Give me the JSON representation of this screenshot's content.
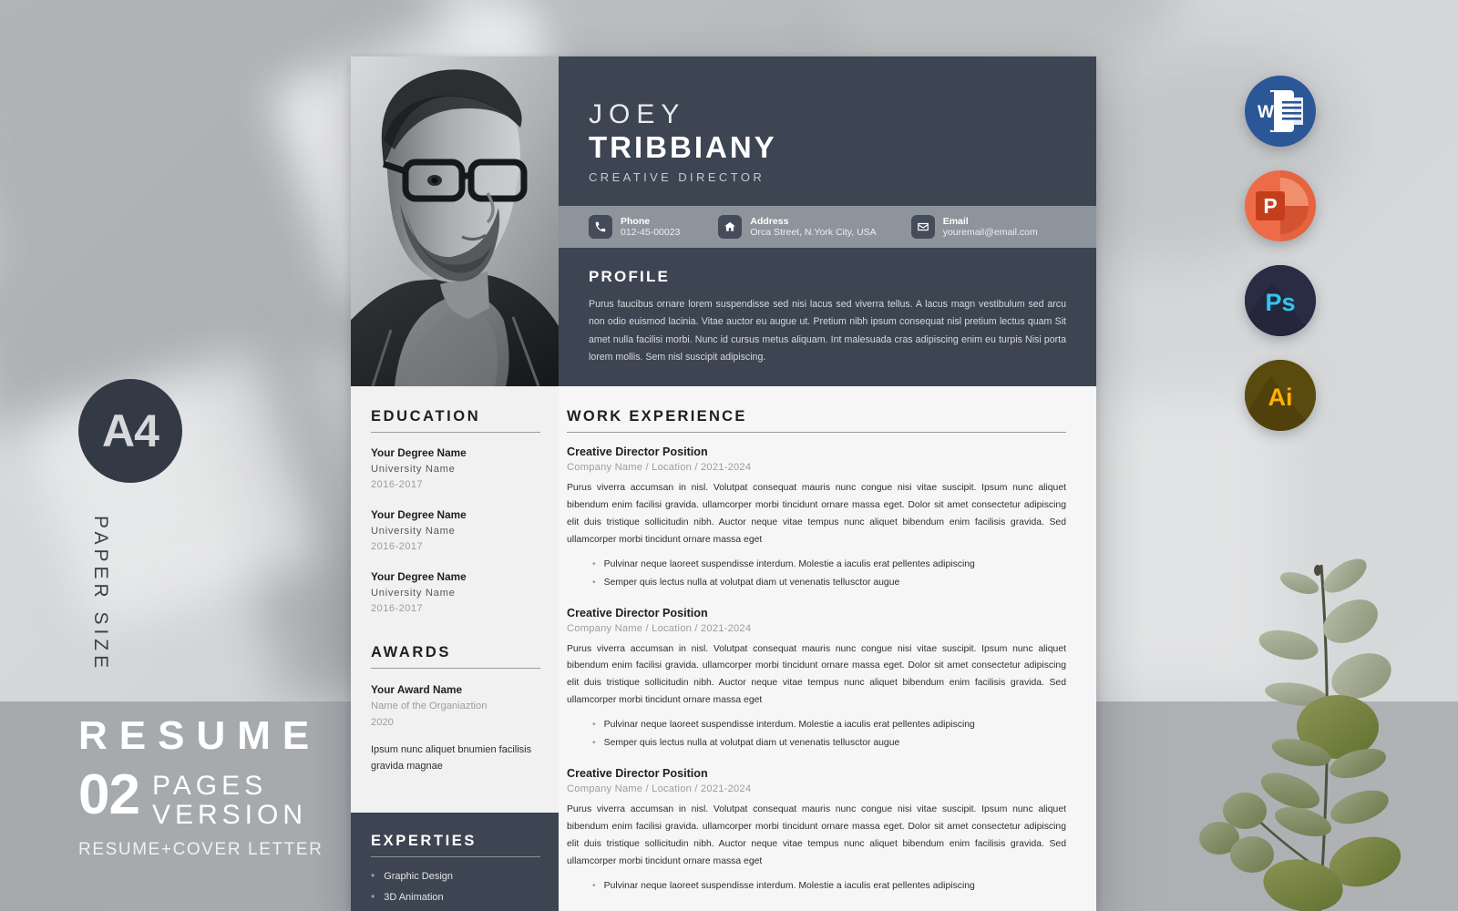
{
  "mockup": {
    "paper_size_badge": "A4",
    "paper_size_label": "PAPER SIZE",
    "banner_title": "RESUME",
    "banner_count": "02",
    "banner_pages": "PAGES",
    "banner_version": "VERSION",
    "banner_subtitle": "RESUME+COVER LETTER"
  },
  "app_icons": [
    {
      "name": "Word",
      "glyph": "W",
      "color": "#2b5797"
    },
    {
      "name": "PowerPoint",
      "glyph": "P",
      "color": "#ed6c47"
    },
    {
      "name": "Photoshop",
      "glyph": "Ps",
      "color": "#2a2c44"
    },
    {
      "name": "Illustrator",
      "glyph": "Ai",
      "color": "#5b4a0e"
    }
  ],
  "resume": {
    "first_name": "JOEY",
    "last_name": "TRIBBIANY",
    "role": "CREATIVE DIRECTOR",
    "contacts": [
      {
        "icon": "phone-icon",
        "label": "Phone",
        "value": "012-45-00023"
      },
      {
        "icon": "home-icon",
        "label": "Address",
        "value": "Orca Street, N.York City, USA"
      },
      {
        "icon": "mail-icon",
        "label": "Email",
        "value": "youremail@email.com"
      }
    ],
    "profile": {
      "heading": "PROFILE",
      "text": "Purus faucibus ornare lorem suspendisse sed nisi lacus sed viverra tellus. A lacus magn vestibulum sed arcu non odio euismod lacinia. Vitae auctor eu augue ut. Pretium nibh ipsum consequat nisl  pretium lectus quam Sit amet nulla facilisi morbi. Nunc id cursus metus aliquam. Int malesuada  cras adipiscing enim eu turpis Nisi porta lorem mollis. Sem nisl suscipit adipiscing."
    },
    "education": {
      "heading": "EDUCATION",
      "items": [
        {
          "degree": "Your Degree Name",
          "university": "University Name",
          "years": "2016-2017"
        },
        {
          "degree": "Your Degree Name",
          "university": "University Name",
          "years": "2016-2017"
        },
        {
          "degree": "Your Degree Name",
          "university": "University Name",
          "years": "2016-2017"
        }
      ]
    },
    "awards": {
      "heading": "AWARDS",
      "name": "Your Award Name",
      "organization": "Name of the Organiaztion",
      "year": "2020",
      "note": "Ipsum nunc aliquet bnumien facilisis gravida magnae"
    },
    "experties": {
      "heading": "EXPERTIES",
      "items": [
        "Graphic Design",
        "3D Animation"
      ]
    },
    "work": {
      "heading": "WORK EXPERIENCE",
      "jobs": [
        {
          "title": "Creative Director Position",
          "meta": "Company Name / Location / 2021-2024",
          "body": "Purus viverra accumsan in nisl. Volutpat consequat mauris nunc congue nisi vitae suscipit. Ipsum nunc aliquet bibendum enim facilisi gravida. ullamcorper morbi tincidunt ornare massa eget. Dolor sit amet consectetur adipiscing elit duis tristique sollicitudin nibh. Auctor neque vitae tempus nunc aliquet bibendum enim facilisis gravida. Sed ullamcorper morbi tincidunt ornare massa eget",
          "bullets": [
            "Pulvinar neque laoreet suspendisse interdum. Molestie a iaculis erat pellentes adipiscing",
            "Semper quis lectus nulla at volutpat diam ut venenatis tellusctor augue"
          ]
        },
        {
          "title": "Creative Director Position",
          "meta": "Company Name / Location / 2021-2024",
          "body": "Purus viverra accumsan in nisl. Volutpat consequat mauris nunc congue nisi vitae suscipit. Ipsum nunc aliquet bibendum enim facilisi gravida. ullamcorper morbi tincidunt ornare massa eget. Dolor sit amet consectetur adipiscing elit duis tristique sollicitudin nibh. Auctor neque vitae tempus nunc aliquet bibendum enim facilisis gravida. Sed ullamcorper morbi tincidunt ornare massa eget",
          "bullets": [
            "Pulvinar neque laoreet suspendisse interdum. Molestie a iaculis erat pellentes adipiscing",
            "Semper quis lectus nulla at volutpat diam ut venenatis tellusctor augue"
          ]
        },
        {
          "title": "Creative Director Position",
          "meta": "Company Name / Location / 2021-2024",
          "body": "Purus viverra accumsan in nisl. Volutpat consequat mauris nunc congue nisi vitae suscipit. Ipsum nunc aliquet bibendum enim facilisi gravida. ullamcorper morbi tincidunt ornare massa eget. Dolor sit amet consectetur adipiscing elit duis tristique sollicitudin nibh. Auctor neque vitae tempus nunc aliquet bibendum enim facilisis gravida. Sed ullamcorper morbi tincidunt ornare massa eget",
          "bullets": [
            "Pulvinar neque laoreet suspendisse interdum. Molestie a iaculis erat pellentes adipiscing"
          ]
        }
      ]
    }
  },
  "colors": {
    "dark": "#3d4452",
    "contact_bar": "#8e949c",
    "band": "#a6a9ac",
    "page": "#f6f6f6"
  }
}
